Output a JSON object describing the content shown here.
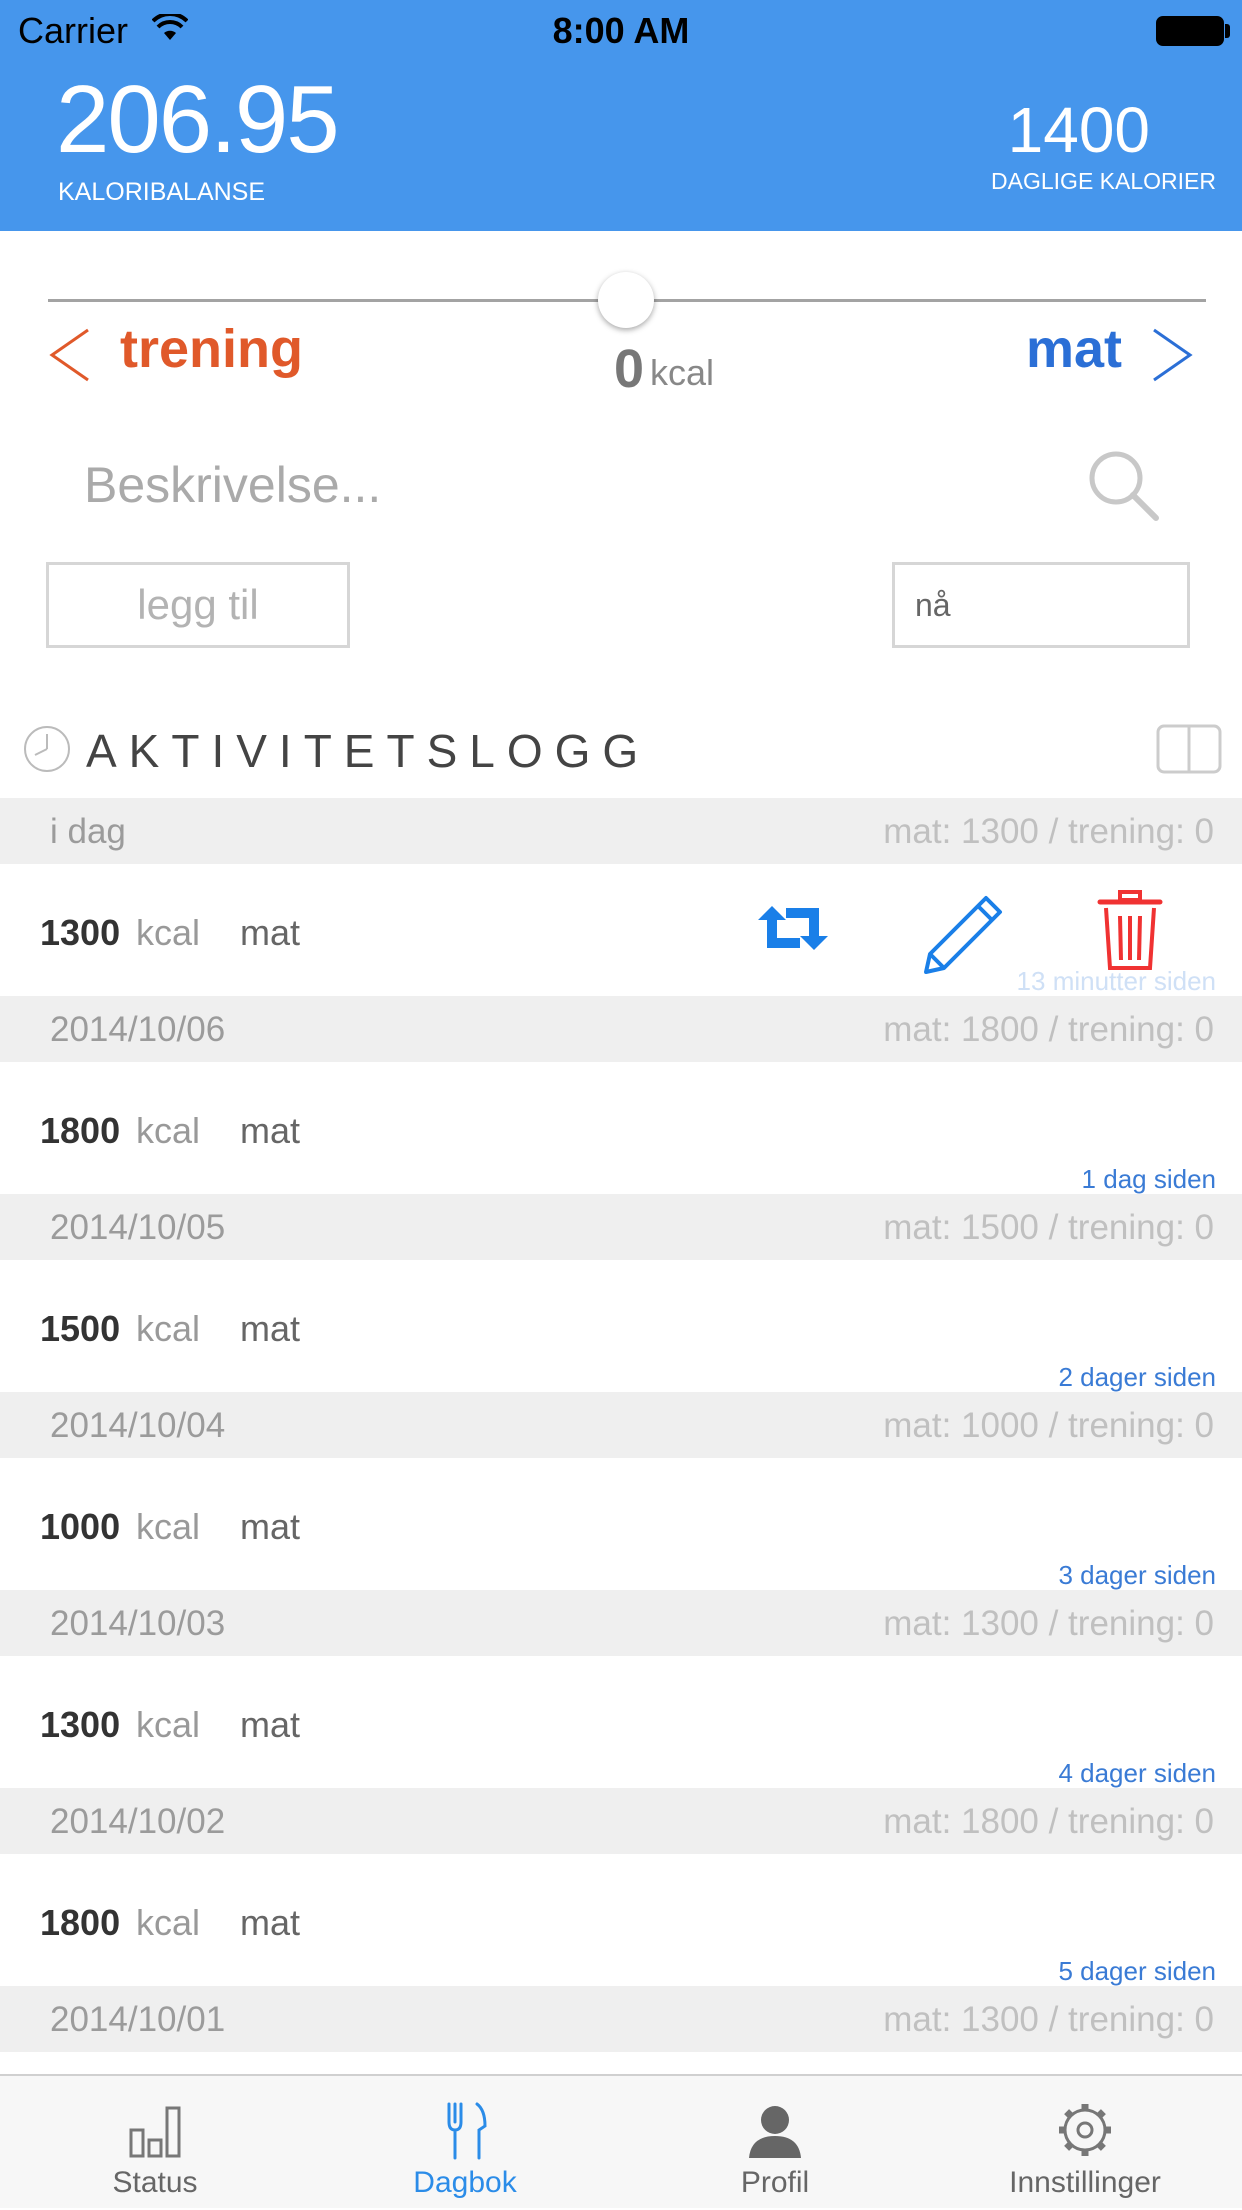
{
  "status_bar": {
    "carrier": "Carrier",
    "time": "8:00 AM"
  },
  "header": {
    "balance": "206.95",
    "balance_label": "KALORIBALANSE",
    "daily": "1400",
    "daily_label": "DAGLIGE KALORIER",
    "background_color": "#4696ec"
  },
  "slider": {
    "value": "0",
    "unit": "kcal",
    "left_label": "trening",
    "right_label": "mat",
    "left_color": "#e0592a",
    "right_color": "#2b6fd6"
  },
  "search": {
    "placeholder": "Beskrivelse...",
    "add_label": "legg til",
    "time_value": "nå"
  },
  "log": {
    "title": "AKTIVITETSLOGG",
    "groups": [
      {
        "date": "i dag",
        "summary": "mat: 1300 / trening: 0",
        "entry": {
          "kcal": "1300",
          "unit": "kcal",
          "type": "mat",
          "ago": "13 minutter siden"
        }
      },
      {
        "date": "2014/10/06",
        "summary": "mat: 1800 / trening: 0",
        "entry": {
          "kcal": "1800",
          "unit": "kcal",
          "type": "mat",
          "ago": "1 dag siden"
        }
      },
      {
        "date": "2014/10/05",
        "summary": "mat: 1500 / trening: 0",
        "entry": {
          "kcal": "1500",
          "unit": "kcal",
          "type": "mat",
          "ago": "2 dager siden"
        }
      },
      {
        "date": "2014/10/04",
        "summary": "mat: 1000 / trening: 0",
        "entry": {
          "kcal": "1000",
          "unit": "kcal",
          "type": "mat",
          "ago": "3 dager siden"
        }
      },
      {
        "date": "2014/10/03",
        "summary": "mat: 1300 / trening: 0",
        "entry": {
          "kcal": "1300",
          "unit": "kcal",
          "type": "mat",
          "ago": "4 dager siden"
        }
      },
      {
        "date": "2014/10/02",
        "summary": "mat: 1800 / trening: 0",
        "entry": {
          "kcal": "1800",
          "unit": "kcal",
          "type": "mat",
          "ago": "5 dager siden"
        }
      },
      {
        "date": "2014/10/01",
        "summary": "mat: 1300 / trening: 0"
      }
    ],
    "row_actions": [
      "repeat-icon",
      "pencil-icon",
      "trash-icon"
    ]
  },
  "tabbar": {
    "tabs": [
      {
        "label": "Status",
        "icon": "bar-chart-icon"
      },
      {
        "label": "Dagbok",
        "icon": "fork-knife-icon",
        "active": true
      },
      {
        "label": "Profil",
        "icon": "person-icon"
      },
      {
        "label": "Innstillinger",
        "icon": "gear-icon"
      }
    ],
    "active_color": "#2b8ce8"
  }
}
